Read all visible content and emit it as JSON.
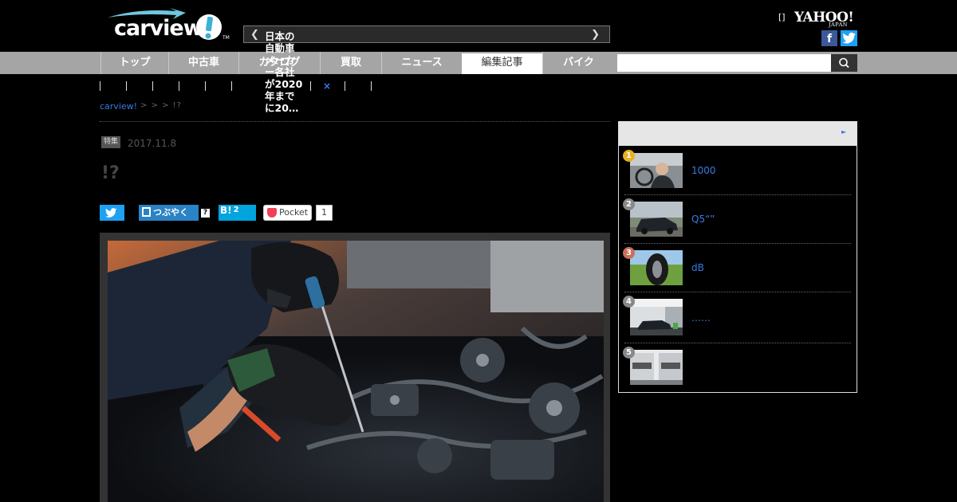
{
  "header": {
    "logo_text": "carview",
    "logo_tm": "TM",
    "ticker_text": "日本の自動車メーカー各社が2020年までに20…",
    "yahoo_bracket": "[]",
    "yahoo_logo": "YAHOO!",
    "yahoo_japan": "JAPAN",
    "facebook_label": "f"
  },
  "nav": {
    "items": [
      {
        "label": "トップ"
      },
      {
        "label": "中古車"
      },
      {
        "label": "カタログ"
      },
      {
        "label": "買取"
      },
      {
        "label": "ニュース"
      },
      {
        "label": "編集記事"
      },
      {
        "label": "バイク"
      }
    ],
    "active_index": 5,
    "search_placeholder": ""
  },
  "subnav": {
    "close_label": "×"
  },
  "breadcrumb": {
    "home": "carview!",
    "rest": "> > > !?"
  },
  "article": {
    "category": "特集",
    "date": "2017.11.8",
    "title": "!?",
    "share": {
      "tsubuyaku": "つぶやく",
      "question": "?",
      "hatena": "B!",
      "hatena_count": "2",
      "pocket": "Pocket",
      "pocket_count": "1"
    }
  },
  "ranking": {
    "items": [
      {
        "rank": "1",
        "text": "1000",
        "color": "#e8b020"
      },
      {
        "rank": "2",
        "text": "Q5“”",
        "color": "#888888"
      },
      {
        "rank": "3",
        "text": "dB",
        "color": "#c9705a"
      },
      {
        "rank": "4",
        "text": "……",
        "color": "#888888"
      },
      {
        "rank": "5",
        "text": "",
        "color": "#888888"
      }
    ]
  },
  "colors": {
    "accent": "#3a7be0",
    "nav_bg": "#a5a5a5",
    "twitter": "#1da1f2",
    "facebook": "#3b5998"
  }
}
